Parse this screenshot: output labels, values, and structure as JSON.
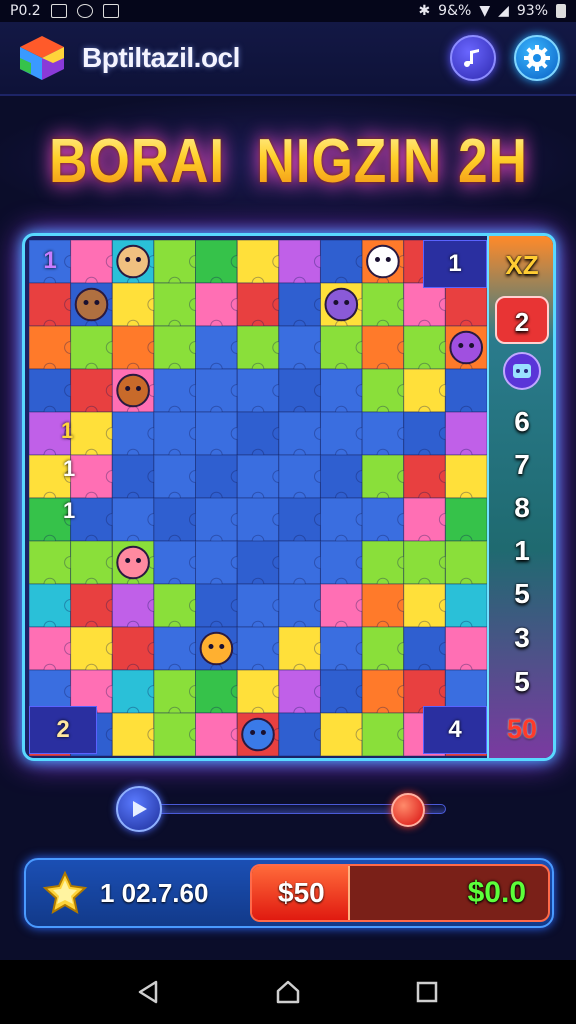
{
  "status_bar": {
    "left_text": "P0.2",
    "battery_text": "9&%",
    "signal_text": "93%",
    "icons": [
      "image-icon",
      "camera-icon",
      "media-icon",
      "bluetooth-icon",
      "wifi-icon",
      "signal-icon",
      "battery-icon"
    ]
  },
  "app_bar": {
    "app_name": "Bptiltazil.ocl",
    "logo_icon": "cube-logo-icon",
    "music_icon": "music-note-icon",
    "settings_icon": "gear-icon",
    "accent_music": "#4a45e8",
    "accent_settings": "#1a8ce8"
  },
  "title": {
    "text": "BORAI  NIGZIN 2H",
    "gradient_colors": [
      "#fff3a0",
      "#ffd02a",
      "#f08a10"
    ],
    "glow_color": "#ff4fd0"
  },
  "board": {
    "rows": 12,
    "cols": 11,
    "corner_labels": {
      "top_left": "1",
      "top_right": "1",
      "bottom_left": "2",
      "bottom_right": "4"
    },
    "left_labels": [
      "1",
      "1",
      "1"
    ],
    "piece_colors": [
      "#3a6ee0",
      "#2f5fd0",
      "#36c24a",
      "#ff6fb4",
      "#ff7a2a",
      "#ffe03a",
      "#2ac0d8",
      "#e84040",
      "#c060e8",
      "#8adf3a"
    ]
  },
  "side_column": {
    "top_icon": "trophy-icon",
    "top_text": "XZ",
    "active": "2",
    "icon": "robot-icon",
    "numbers": [
      "6",
      "7",
      "8",
      "1",
      "5",
      "3",
      "5"
    ],
    "final": "50"
  },
  "slider": {
    "play_icon": "play-icon",
    "position": 0.92
  },
  "bottom_panel": {
    "gem_icon": "star-gem-icon",
    "score": "1 02.7.60",
    "money_left": "$50",
    "money_right": "$0.0",
    "money_fill_fraction": 0.33
  },
  "nav_bar": {
    "back_icon": "back-triangle-icon",
    "home_icon": "home-icon",
    "recents_icon": "recents-square-icon"
  }
}
